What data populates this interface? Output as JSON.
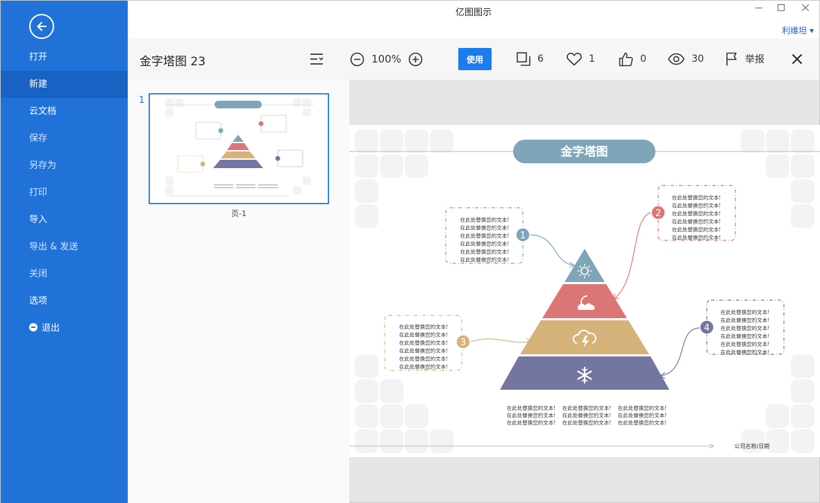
{
  "sidebar": {
    "items": [
      {
        "label": "打开"
      },
      {
        "label": "新建"
      },
      {
        "label": "云文档"
      },
      {
        "label": "保存"
      },
      {
        "label": "另存为"
      },
      {
        "label": "打印"
      },
      {
        "label": "导入"
      },
      {
        "label": "导出 & 发送"
      },
      {
        "label": "关闭"
      },
      {
        "label": "选项"
      },
      {
        "label": "退出"
      }
    ]
  },
  "window": {
    "title": "亿图图示",
    "user": "利维坦 ▾"
  },
  "toolbar": {
    "doc_title": "金字塔图 23",
    "zoom": "100%",
    "use_label": "使用",
    "copies": "6",
    "likes": "1",
    "thumbs": "0",
    "views": "30",
    "report_label": "举报"
  },
  "pages": {
    "page_number": "1",
    "page_label": "页-1"
  },
  "diagram": {
    "title": "金字塔图",
    "placeholder_line": "在此处替换您的文本!",
    "markers": [
      "1",
      "2",
      "3",
      "4"
    ],
    "footer": "公司名称/日期",
    "colors": {
      "blue": "#7fa5b8",
      "red": "#db7676",
      "gold": "#d6b37a",
      "purple": "#7376a0",
      "accent": "#2072d9"
    }
  }
}
